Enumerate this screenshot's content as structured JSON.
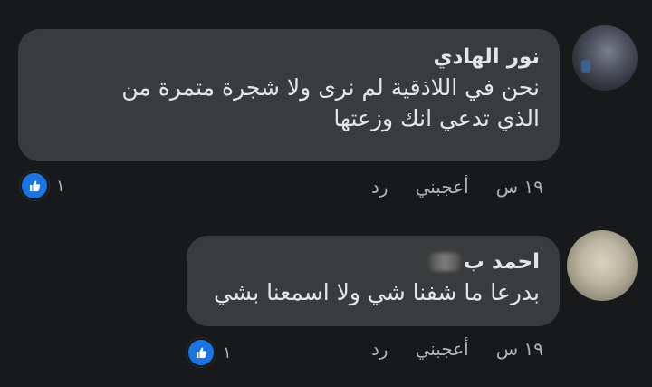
{
  "comments": [
    {
      "author": "نور الهادي",
      "text_line1": "نحن في اللاذقية لم نرى ولا شجرة متمرة  من",
      "text_line2": "الذي تدعي انك وزعتها",
      "time": "١٩ س",
      "like_label": "أعجبني",
      "reply_label": "رد",
      "reaction_count": "١"
    },
    {
      "author": "احمد ب",
      "text": "بدرعا ما شفنا شي ولا اسمعنا بشي",
      "time": "١٩ س",
      "like_label": "أعجبني",
      "reply_label": "رد",
      "reaction_count": "١"
    }
  ],
  "icons": {
    "reaction": "thumbs-up-icon",
    "reaction_color": "#1b74e4"
  },
  "colors": {
    "background": "#18191a",
    "bubble": "#3a3b3c",
    "text": "#e4e6eb",
    "secondary_text": "#b0b3b8"
  }
}
